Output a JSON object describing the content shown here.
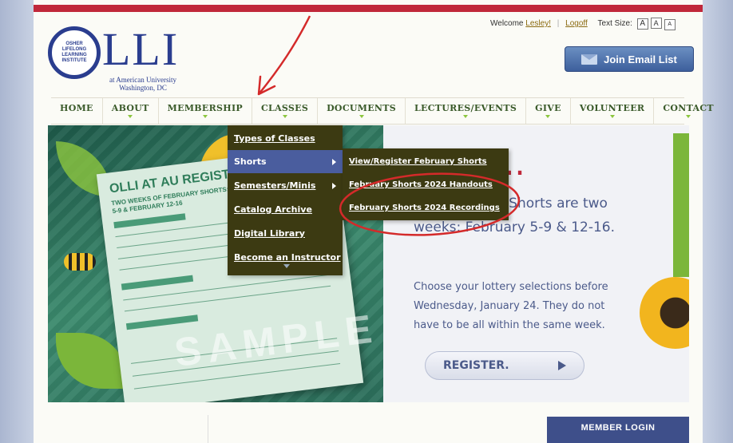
{
  "logo": {
    "o_text": "OSHER LIFELONG LEARNING INSTITUTE",
    "lli": "LLI",
    "subtitle": "at American University Washington, DC"
  },
  "utility": {
    "welcome": "Welcome",
    "user_link": "Lesley!",
    "logoff": "Logoff",
    "text_size_label": "Text Size:",
    "size_buttons": [
      "A",
      "A",
      "A"
    ]
  },
  "join_button": "Join Email List",
  "nav": {
    "items": [
      "HOME",
      "ABOUT",
      "MEMBERSHIP",
      "CLASSES",
      "DOCUMENTS",
      "LECTURES/EVENTS",
      "GIVE",
      "VOLUNTEER",
      "CONTACT"
    ]
  },
  "classes_menu": {
    "items": [
      "Types of Classes",
      "Shorts",
      "Semesters/Minis",
      "Catalog Archive",
      "Digital Library",
      "Become an Instructor"
    ]
  },
  "shorts_menu": {
    "items": [
      "View/Register February Shorts",
      "February Shorts 2024 Handouts",
      "February Shorts 2024 Recordings"
    ]
  },
  "hero": {
    "form_title": "OLLI AT AU REGISTRATION FO",
    "form_sub": "TWO WEEKS OF FEBRUARY SHORTS: FEBRUARY 5-9 & FEBRUARY 12-16",
    "watermark": "SAMPLE",
    "heading": "ter...",
    "paragraph1": "y Shorts! The Shorts are two weeks: February 5-9 & 12-16.",
    "paragraph2": "Choose your lottery selections before Wednesday, January 24. They do not have to be all within the same week.",
    "register_button": "REGISTER."
  },
  "member_login": "MEMBER LOGIN",
  "colors": {
    "brand_blue": "#2a3d8f",
    "nav_green": "#3a5a2a",
    "menu_bg": "#3c3a12",
    "menu_active": "#4a5d9e",
    "accent_red": "#c0283a"
  }
}
